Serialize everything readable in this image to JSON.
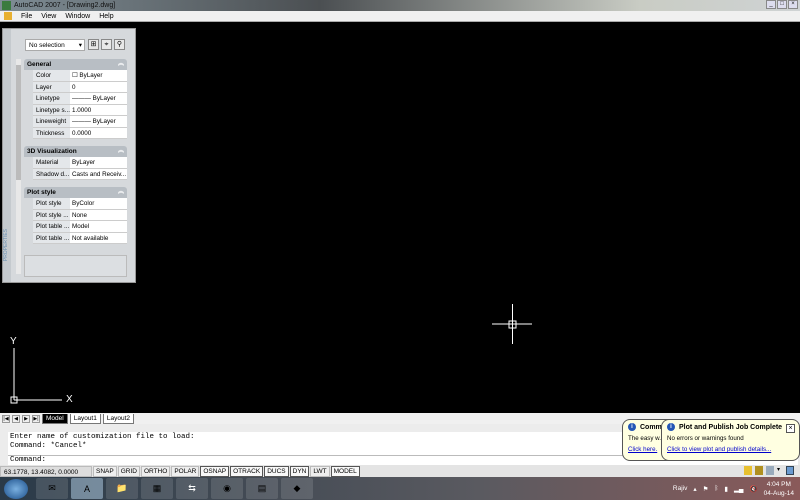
{
  "window": {
    "title": "AutoCAD 2007 - [Drawing2.dwg]",
    "controls": [
      "_",
      "□",
      "×"
    ]
  },
  "menu": [
    "File",
    "View",
    "Window",
    "Help"
  ],
  "properties": {
    "selection": "No selection",
    "side_label": "PROPERTIES",
    "sections": [
      {
        "title": "General",
        "rows": [
          [
            "Color",
            "☐ ByLayer"
          ],
          [
            "Layer",
            "0"
          ],
          [
            "Linetype",
            "——— ByLayer"
          ],
          [
            "Linetype s...",
            "1.0000"
          ],
          [
            "Lineweight",
            "——— ByLayer"
          ],
          [
            "Thickness",
            "0.0000"
          ]
        ]
      },
      {
        "title": "3D Visualization",
        "rows": [
          [
            "Material",
            "ByLayer"
          ],
          [
            "Shadow d...",
            "Casts and Receiv..."
          ]
        ]
      },
      {
        "title": "Plot style",
        "rows": [
          [
            "Plot style",
            "ByColor"
          ],
          [
            "Plot style ...",
            "None"
          ],
          [
            "Plot table ...",
            "Model"
          ],
          [
            "Plot table ...",
            "Not available"
          ]
        ]
      }
    ]
  },
  "ucs": {
    "x": "X",
    "y": "Y"
  },
  "tabs": {
    "nav": [
      "|◀",
      "◀",
      "▶",
      "▶|"
    ],
    "items": [
      "Model",
      "Layout1",
      "Layout2"
    ]
  },
  "command": {
    "history": [
      "Enter name of customization file to load:",
      "Command: *Cancel*"
    ],
    "prompt": "Command:"
  },
  "status": {
    "coords": "63.1778, 13.4082, 0.0000",
    "buttons": [
      {
        "label": "SNAP",
        "on": false
      },
      {
        "label": "GRID",
        "on": false
      },
      {
        "label": "ORTHO",
        "on": false
      },
      {
        "label": "POLAR",
        "on": false
      },
      {
        "label": "OSNAP",
        "on": true
      },
      {
        "label": "OTRACK",
        "on": true
      },
      {
        "label": "DUCS",
        "on": true
      },
      {
        "label": "DYN",
        "on": true
      },
      {
        "label": "LWT",
        "on": false
      },
      {
        "label": "MODEL",
        "on": true
      }
    ]
  },
  "balloons": {
    "back": {
      "title": "Comm...",
      "text": "The easy w...",
      "link": "Click here."
    },
    "front": {
      "title": "Plot and Publish Job Complete",
      "text": "No errors or warnings found",
      "link": "Click to view plot and publish details..."
    }
  },
  "taskbar": {
    "user": "Rajiv",
    "time": "4:04 PM",
    "date": "04-Aug-14"
  }
}
